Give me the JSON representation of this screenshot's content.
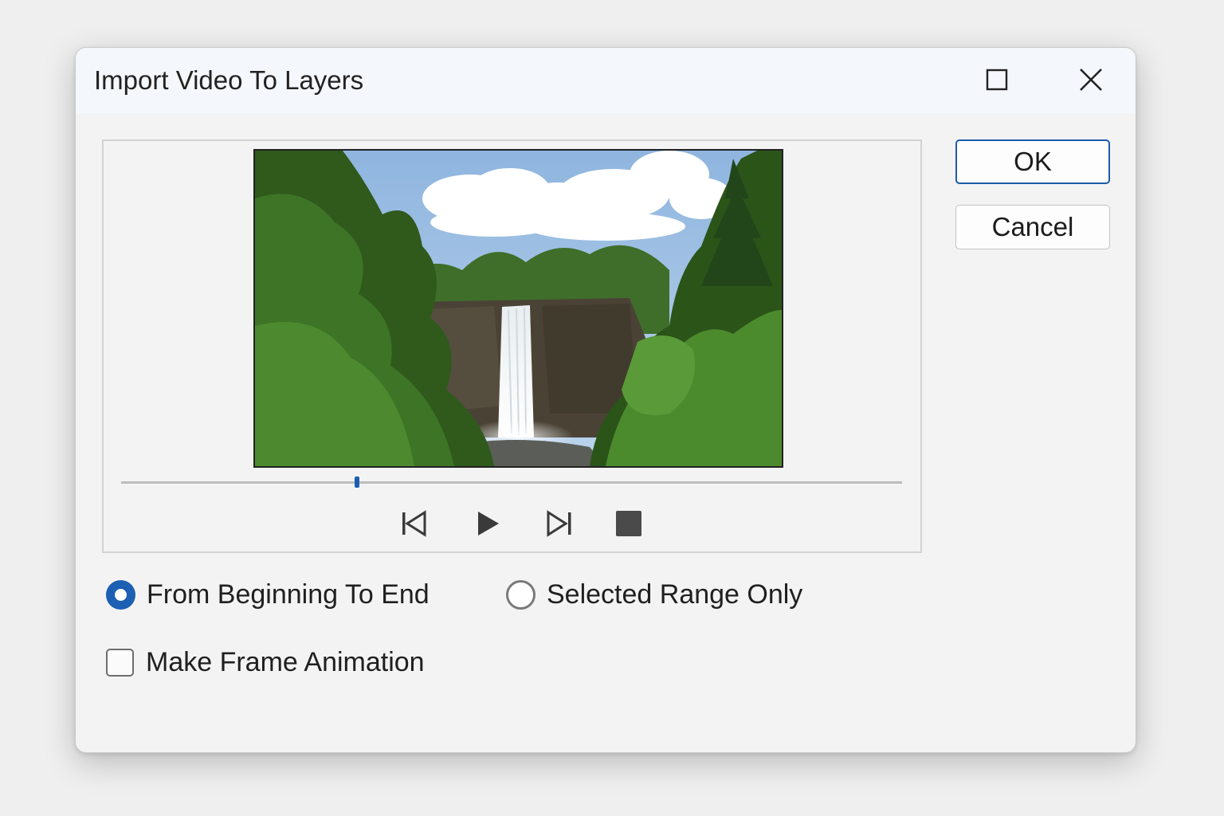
{
  "dialog": {
    "title": "Import Video To Layers",
    "maximize_icon": "maximize-square-icon",
    "close_icon": "close-x-icon"
  },
  "buttons": {
    "ok_label": "OK",
    "cancel_label": "Cancel"
  },
  "playback": {
    "position_fraction": 0.302,
    "controls": [
      "skip-to-start-icon",
      "play-icon",
      "skip-to-end-icon",
      "stop-icon"
    ]
  },
  "options": {
    "range": [
      {
        "label": "From Beginning To End",
        "checked": true
      },
      {
        "label": "Selected Range Only",
        "checked": false
      }
    ],
    "make_frame_animation": {
      "label": "Make Frame Animation",
      "checked": false
    }
  },
  "colors": {
    "accent": "#1c5fb3"
  }
}
